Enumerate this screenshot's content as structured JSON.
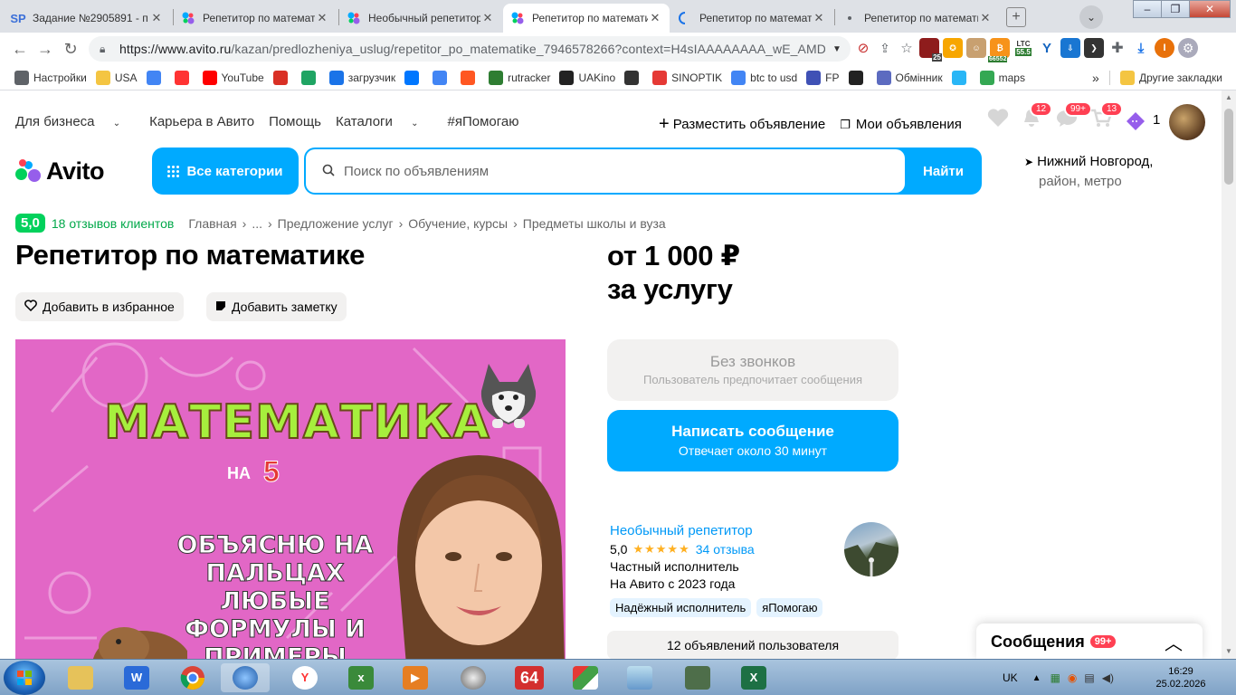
{
  "browser": {
    "tabs": [
      {
        "title": "Задание №2905891 - п",
        "icon": "sp-icon",
        "active": false
      },
      {
        "title": "Репетитор по математи",
        "icon": "avito-icon",
        "active": false
      },
      {
        "title": "Необычный репетитор",
        "icon": "avito-icon",
        "active": false
      },
      {
        "title": "Репетитор по математи",
        "icon": "avito-icon",
        "active": true
      },
      {
        "title": "Репетитор по математи",
        "icon": "loading-icon",
        "active": false
      },
      {
        "title": "Репетитор по математи",
        "icon": "dot-icon",
        "active": false
      }
    ],
    "url_host": "https://www.avito.ru",
    "url_path": "/kazan/predlozheniya_uslug/repetitor_po_matematike_7946578266?context=H4sIAAAAAAAA_wE_AMD_Y...",
    "ext_badges": {
      "b1": "25",
      "b2": "66552",
      "b3": "LTC",
      "b4": "55.5"
    },
    "bookmarks": [
      {
        "label": "Настройки",
        "icon": "gear-icon",
        "color": "#5f6368"
      },
      {
        "label": "USA",
        "icon": "folder-icon",
        "color": "#f4c542"
      },
      {
        "label": "",
        "icon": "google-icon",
        "color": "#4285f4"
      },
      {
        "label": "",
        "icon": "yandex-icon",
        "color": "#ff3333"
      },
      {
        "label": "YouTube",
        "icon": "youtube-icon",
        "color": "#ff0000"
      },
      {
        "label": "",
        "icon": "gmail-icon",
        "color": "#d93025"
      },
      {
        "label": "",
        "icon": "drive-icon",
        "color": "#1fa463"
      },
      {
        "label": "загрузчик",
        "icon": "infinity-icon",
        "color": "#1a73e8"
      },
      {
        "label": "",
        "icon": "vk-icon",
        "color": "#0077ff"
      },
      {
        "label": "",
        "icon": "translate-icon",
        "color": "#4285f4"
      },
      {
        "label": "",
        "icon": "f-icon",
        "color": "#ff5722"
      },
      {
        "label": "rutracker",
        "icon": "rutracker-icon",
        "color": "#2e7d32"
      },
      {
        "label": "UAKino",
        "icon": "uakino-icon",
        "color": "#222222"
      },
      {
        "label": "",
        "icon": "chess-icon",
        "color": "#333333"
      },
      {
        "label": "SINOPTIK",
        "icon": "thermometer-icon",
        "color": "#e53935"
      },
      {
        "label": "btc to usd",
        "icon": "google-icon",
        "color": "#4285f4"
      },
      {
        "label": "FP",
        "icon": "fp-icon",
        "color": "#3f51b5"
      },
      {
        "label": "",
        "icon": "bc-icon",
        "color": "#222222"
      },
      {
        "label": "Обмінник",
        "icon": "exchange-icon",
        "color": "#5c6bc0"
      },
      {
        "label": "",
        "icon": "star-burst-icon",
        "color": "#29b6f6"
      },
      {
        "label": "maps",
        "icon": "maps-pin-icon",
        "color": "#34a853"
      }
    ],
    "bookmarks_more": "»",
    "other_bookmarks": "Другие закладки"
  },
  "avito": {
    "topnav": [
      "Для бизнеса",
      "Карьера в Авито",
      "Помощь",
      "Каталоги",
      "#яПомогаю"
    ],
    "place_ad": "Разместить объявление",
    "my_ads": "Мои объявления",
    "badges": {
      "notifications": "12",
      "messages": "99+",
      "cart": "13",
      "favorites_count": "1"
    },
    "logo_text": "Avito",
    "all_categories": "Все категории",
    "search_placeholder": "Поиск по объявлениям",
    "search_button": "Найти",
    "location_city": "Нижний Новгород,",
    "location_sub": "район, метро",
    "rating": "5,0",
    "reviews_link": "18 отзывов клиентов",
    "breadcrumbs": [
      "Главная",
      "›",
      "...",
      "›",
      "Предложение услуг",
      "›",
      "Обучение, курсы",
      "›",
      "Предметы школы и вуза"
    ],
    "title": "Репетитор по математике",
    "price_line1": "от 1 000 ₽",
    "price_line2": "за услугу",
    "add_favorite": "Добавить в избранное",
    "add_note": "Добавить заметку",
    "hero": {
      "headline": "МАТЕМАТИКА",
      "na": "НА",
      "five": "5",
      "lines": [
        "ОБЪЯСНЮ НА",
        "ПАЛЬЦАХ ЛЮБЫЕ",
        "ФОРМУЛЫ И",
        "ПРИМЕРЫ"
      ]
    },
    "no_calls_title": "Без звонков",
    "no_calls_sub": "Пользователь предпочитает сообщения",
    "write_message": "Написать сообщение",
    "write_message_sub": "Отвечает около 30 минут",
    "seller": {
      "name": "Необычный репетитор",
      "rating": "5,0",
      "stars": "★★★★★",
      "reviews": "34 отзыва",
      "type": "Частный исполнитель",
      "since": "На Авито с 2023 года",
      "tags": [
        "Надёжный исполнитель",
        "яПомогаю"
      ]
    },
    "user_ads": "12 объявлений пользователя",
    "messages_panel": "Сообщения",
    "messages_badge": "99+"
  },
  "taskbar": {
    "lang": "UK",
    "time": "16:29",
    "date": "25.02.2026",
    "app_64": "64"
  },
  "colors": {
    "avito_blue": "#00aaff",
    "avito_green": "#02d15c",
    "badge_red": "#ff4053",
    "hero_pink": "#e267c6",
    "hero_text_green": "#a6ef3d"
  }
}
